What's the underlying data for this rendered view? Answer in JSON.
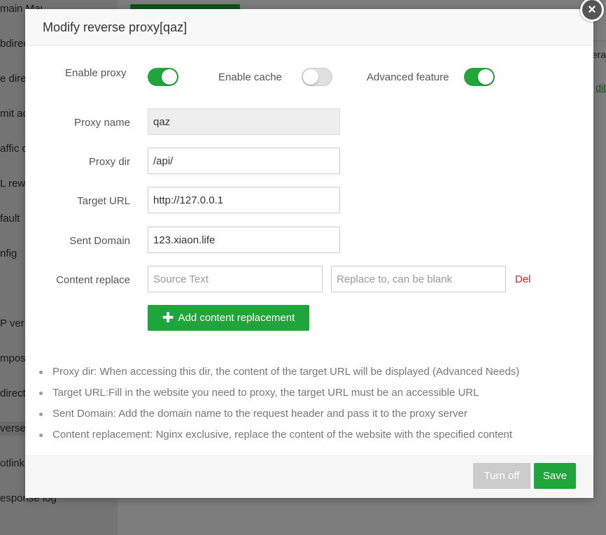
{
  "background": {
    "sidebar_items": [
      "main Manager",
      "bdirect",
      "e direc",
      "mit ac",
      "affic co",
      "L rew",
      "fault",
      "nfig",
      "",
      "P ver",
      "mpos",
      "direct",
      "verse",
      "otlink",
      "esponse log"
    ],
    "right_texts": [
      "era",
      "dit"
    ]
  },
  "dialog": {
    "title": "Modify reverse proxy[qaz]",
    "close_label": "×",
    "toggles": {
      "enable_proxy": {
        "label": "Enable proxy",
        "on": true
      },
      "enable_cache": {
        "label": "Enable cache",
        "on": false
      },
      "advanced_feature": {
        "label": "Advanced feature",
        "on": true
      }
    },
    "fields": {
      "proxy_name": {
        "label": "Proxy name",
        "value": "qaz"
      },
      "proxy_dir": {
        "label": "Proxy dir",
        "value": "/api/"
      },
      "target_url": {
        "label": "Target URL",
        "value": "http://127.0.0.1"
      },
      "sent_domain": {
        "label": "Sent Domain",
        "value": "123.xiaon.life"
      }
    },
    "content_replace": {
      "label": "Content replace",
      "source_placeholder": "Source Text",
      "replace_placeholder": "Replace to, can be blank",
      "del_label": "Del",
      "add_label": "Add content replacement"
    },
    "notes": [
      "Proxy dir: When accessing this dir, the content of the target URL will be displayed (Advanced Needs)",
      "Target URL:Fill in the website you need to proxy, the target URL must be an accessible URL",
      "Sent Domain: Add the domain name to the request header and pass it to the proxy server",
      "Content replacement: Nginx exclusive, replace the content of the website with the specified content"
    ],
    "footer": {
      "turn_off_label": "Turn off",
      "save_label": "Save"
    }
  },
  "colors": {
    "accent": "#20a53a",
    "danger": "#e02020",
    "disabled_button": "#cbcbcb"
  }
}
